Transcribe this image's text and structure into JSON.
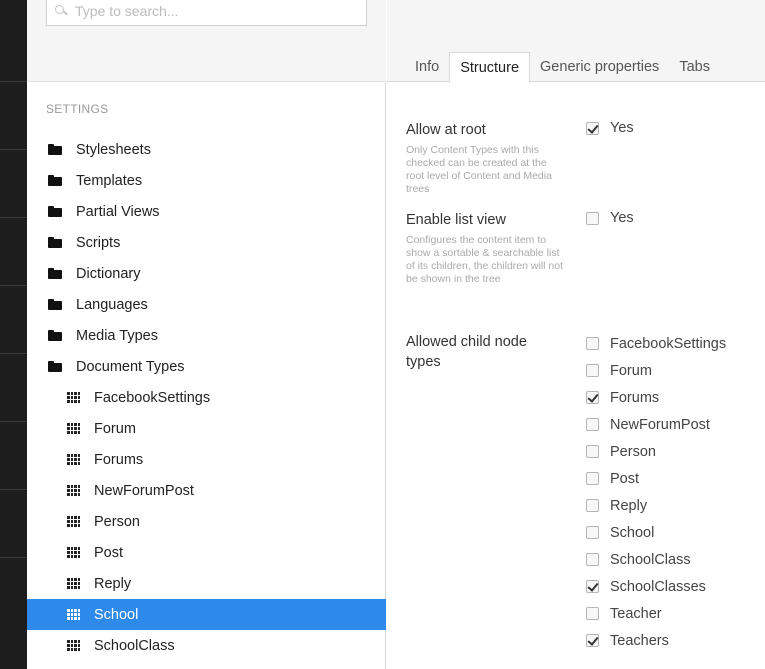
{
  "search": {
    "placeholder": "Type to search..."
  },
  "tree": {
    "section_title": "Settings",
    "folders": [
      {
        "label": "Stylesheets"
      },
      {
        "label": "Templates"
      },
      {
        "label": "Partial Views"
      },
      {
        "label": "Scripts"
      },
      {
        "label": "Dictionary"
      },
      {
        "label": "Languages"
      },
      {
        "label": "Media Types"
      },
      {
        "label": "Document Types"
      }
    ],
    "document_types": [
      {
        "label": "FacebookSettings",
        "selected": false
      },
      {
        "label": "Forum",
        "selected": false
      },
      {
        "label": "Forums",
        "selected": false
      },
      {
        "label": "NewForumPost",
        "selected": false
      },
      {
        "label": "Person",
        "selected": false
      },
      {
        "label": "Post",
        "selected": false
      },
      {
        "label": "Reply",
        "selected": false
      },
      {
        "label": "School",
        "selected": true
      },
      {
        "label": "SchoolClass",
        "selected": false
      }
    ]
  },
  "tabs": [
    {
      "label": "Info",
      "active": false
    },
    {
      "label": "Structure",
      "active": true
    },
    {
      "label": "Generic properties",
      "active": false
    },
    {
      "label": "Tabs",
      "active": false
    }
  ],
  "structure": {
    "allow_at_root": {
      "label": "Allow at root",
      "description": "Only Content Types with this checked can be created at the root level of Content and Media trees",
      "option_label": "Yes",
      "checked": true
    },
    "enable_list_view": {
      "label": "Enable list view",
      "description": "Configures the content item to show a sortable & searchable list of its children, the children will not be shown in the tree",
      "option_label": "Yes",
      "checked": false
    },
    "allowed_child_node_types": {
      "label": "Allowed child node types",
      "options": [
        {
          "label": "FacebookSettings",
          "checked": false
        },
        {
          "label": "Forum",
          "checked": false
        },
        {
          "label": "Forums",
          "checked": true
        },
        {
          "label": "NewForumPost",
          "checked": false
        },
        {
          "label": "Person",
          "checked": false
        },
        {
          "label": "Post",
          "checked": false
        },
        {
          "label": "Reply",
          "checked": false
        },
        {
          "label": "School",
          "checked": false
        },
        {
          "label": "SchoolClass",
          "checked": false
        },
        {
          "label": "SchoolClasses",
          "checked": true
        },
        {
          "label": "Teacher",
          "checked": false
        },
        {
          "label": "Teachers",
          "checked": true
        }
      ]
    }
  },
  "colors": {
    "selected": "#2e8aea",
    "rail": "#1d1d1d"
  }
}
